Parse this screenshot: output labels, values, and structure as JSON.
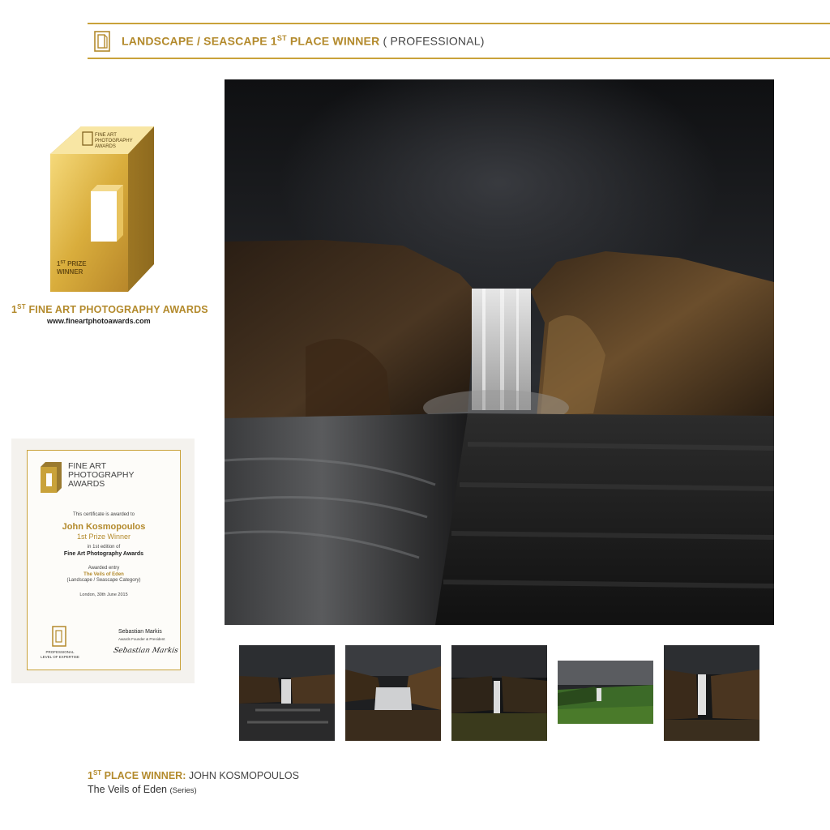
{
  "header": {
    "category": "LANDSCAPE / SEASCAPE 1",
    "ordinal_suffix": "ST",
    "place": " PLACE WINNER",
    "level": " ( PROFESSIONAL)"
  },
  "award_badge": {
    "brand_line1": "FINE ART",
    "brand_line2": "PHOTOGRAPHY",
    "brand_line3": "AWARDS",
    "prize_number": "1",
    "prize_suffix": "ST",
    "prize_line1": " PRIZE",
    "prize_line2": "WINNER"
  },
  "award_name": {
    "number": "1",
    "suffix": "ST",
    "text": " FINE ART PHOTOGRAPHY AWARDS"
  },
  "award_url": "www.fineartphotoawards.com",
  "certificate": {
    "brand_line1": "FINE ART",
    "brand_line2": "PHOTOGRAPHY",
    "brand_line3": "AWARDS",
    "awarded_to": "This certificate is awarded to",
    "recipient": "John Kosmopoulos",
    "prize": "1st Prize Winner",
    "edition": "in 1st edition of",
    "event": "Fine Art Photography Awards",
    "entry_label": "Awarded entry",
    "entry_title": "The Veils of Eden",
    "entry_category": "(Landscape / Seascape Category)",
    "date": "London, 30th June 2015",
    "seal_line1": "PROFESSIONAL",
    "seal_line2": "LEVEL OF EXPERTISE",
    "signer": "Sebastian Markis",
    "signer_title": "Awards Founder & President",
    "signature": "Sebastian Markis"
  },
  "caption": {
    "number": "1",
    "suffix": "ST",
    "title": " PLACE WINNER:",
    "name": " JOHN KOSMOPOULOS",
    "series_title": "The Veils of Eden ",
    "series_note": "(Series)"
  },
  "colors": {
    "gold": "#c9a23a",
    "gold_text": "#b38a2c"
  },
  "icons": [
    "fine-art-awards-logo",
    "gold-award-trophy",
    "certificate-seal"
  ]
}
